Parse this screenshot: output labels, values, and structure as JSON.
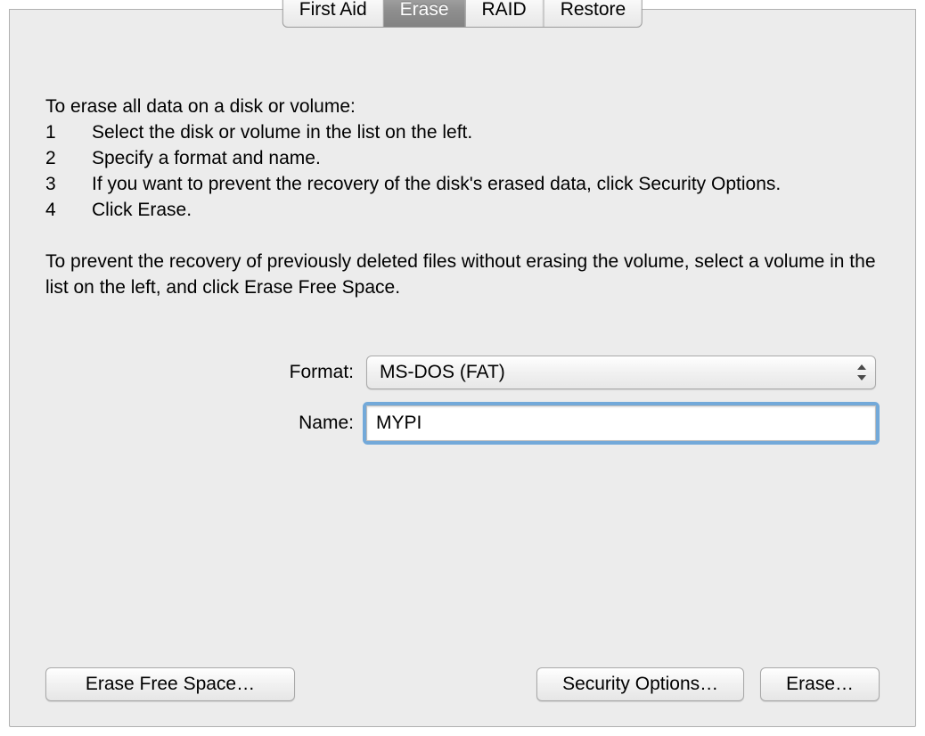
{
  "tabs": {
    "first_aid": "First Aid",
    "erase": "Erase",
    "raid": "RAID",
    "restore": "Restore",
    "active": "erase"
  },
  "instructions": {
    "heading": "To erase all data on a disk or volume:",
    "steps": [
      "Select the disk or volume in the list on the left.",
      "Specify a format and name.",
      "If you want to prevent the recovery of the disk's erased data, click Security Options.",
      "Click Erase."
    ],
    "footer": "To prevent the recovery of previously deleted files without erasing the volume, select a volume in the list on the left, and click Erase Free Space."
  },
  "form": {
    "format_label": "Format:",
    "format_value": "MS-DOS (FAT)",
    "name_label": "Name:",
    "name_value": "MYPI"
  },
  "buttons": {
    "erase_free_space": "Erase Free Space…",
    "security_options": "Security Options…",
    "erase": "Erase…"
  }
}
